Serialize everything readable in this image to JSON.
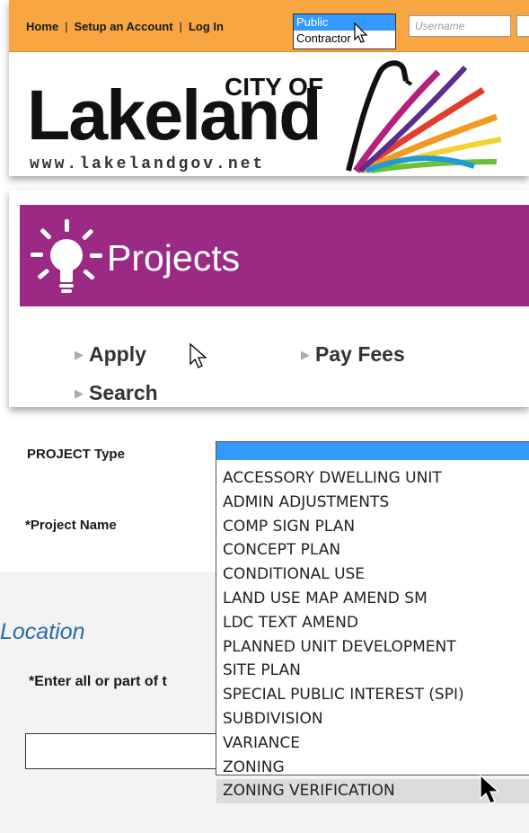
{
  "header": {
    "nav": [
      "Home",
      "Setup an Account",
      "Log In"
    ],
    "user_types": [
      "Public",
      "Contractor"
    ],
    "selected_user_type": "Public",
    "username_placeholder": "Username"
  },
  "logo": {
    "city_of": "CITY OF",
    "name": "Lakeland",
    "url": "www.lakelandgov.net"
  },
  "projects": {
    "title": "Projects",
    "links": {
      "apply": "Apply",
      "pay_fees": "Pay Fees",
      "search": "Search"
    }
  },
  "form": {
    "project_type_label": "PROJECT Type",
    "project_name_label": "*Project Name",
    "location_title": "Location",
    "address_label": "*Enter all or part of t",
    "project_type_options": [
      "ACCESSORY DWELLING UNIT",
      "ADMIN ADJUSTMENTS",
      "COMP SIGN PLAN",
      "CONCEPT PLAN",
      "CONDITIONAL USE",
      "LAND USE MAP AMEND SM",
      "LDC TEXT AMEND",
      "PLANNED UNIT DEVELOPMENT",
      "SITE PLAN",
      "SPECIAL PUBLIC INTEREST (SPI)",
      "SUBDIVISION",
      "VARIANCE",
      "ZONING",
      "ZONING VERIFICATION"
    ],
    "hovered_option": "ZONING VERIFICATION"
  },
  "colors": {
    "topbar": "#f7a642",
    "banner": "#9b2a85",
    "selection": "#3399ff",
    "location_title": "#2d6aa6"
  }
}
